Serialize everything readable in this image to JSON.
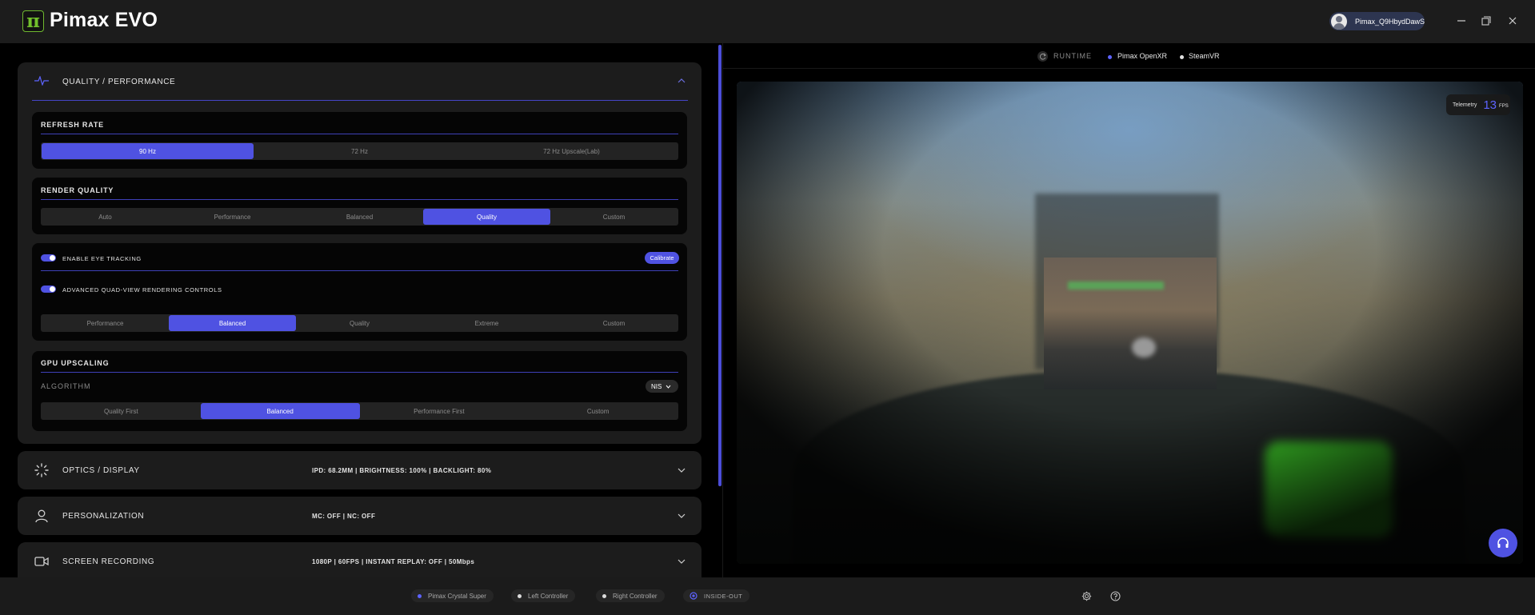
{
  "app": {
    "logo_glyph": "π",
    "title": "Pimax EVO",
    "user": "Pimax_Q9HbydDawS"
  },
  "quality": {
    "title": "QUALITY / PERFORMANCE",
    "refresh": {
      "title": "REFRESH RATE",
      "options": [
        "90 Hz",
        "72 Hz",
        "72 Hz Upscale(Lab)"
      ],
      "selected": "90 Hz"
    },
    "render": {
      "title": "RENDER QUALITY",
      "options": [
        "Auto",
        "Performance",
        "Balanced",
        "Quality",
        "Custom"
      ],
      "selected": "Quality"
    },
    "eye": {
      "label": "ENABLE EYE TRACKING",
      "enabled": true,
      "calibrate": "Calibrate"
    },
    "quadview": {
      "label": "ADVANCED QUAD-VIEW RENDERING CONTROLS",
      "enabled": true,
      "options": [
        "Performance",
        "Balanced",
        "Quality",
        "Extreme",
        "Custom"
      ],
      "selected": "Balanced"
    },
    "upscaling": {
      "title": "GPU UPSCALING",
      "algorithm_label": "ALGORITHM",
      "algorithm_value": "NIS",
      "options": [
        "Quality First",
        "Balanced",
        "Performance First",
        "Custom"
      ],
      "selected": "Balanced"
    }
  },
  "optics": {
    "title": "OPTICS / DISPLAY",
    "summary": "IPD: 68.2MM | BRIGHTNESS: 100% | BACKLIGHT: 80%"
  },
  "personalization": {
    "title": "PERSONALIZATION",
    "summary": "MC: OFF | NC: OFF"
  },
  "recording": {
    "title": "SCREEN RECORDING",
    "summary": "1080P | 60FPS | INSTANT REPLAY: OFF | 50Mbps"
  },
  "runtime": {
    "label": "RUNTIME",
    "options": [
      "Pimax OpenXR",
      "SteamVR"
    ]
  },
  "telemetry": {
    "label": "Telemetry",
    "value": "13",
    "unit": "FPS"
  },
  "status": {
    "devices": [
      "Pimax Crystal Super",
      "Left Controller",
      "Right Controller"
    ],
    "tracking": "INSIDE-OUT"
  },
  "colors": {
    "accent": "#4f52e2",
    "logo_green": "#72c02c"
  }
}
